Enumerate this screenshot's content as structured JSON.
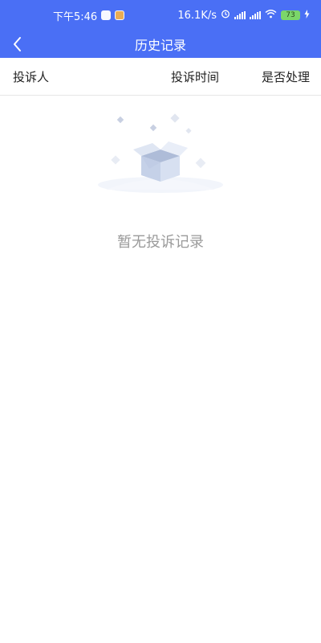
{
  "status_bar": {
    "time": "下午5:46",
    "network_speed": "16.1K/s",
    "battery_level": "73"
  },
  "header": {
    "title": "历史记录",
    "back_icon": "chevron-left-icon"
  },
  "table_header": {
    "complainant": "投诉人",
    "complaint_time": "投诉时间",
    "handled": "是否处理"
  },
  "empty_state": {
    "message": "暂无投诉记录",
    "illustration": "empty-box-illustration"
  },
  "colors": {
    "brand_blue": "#4a6ff5",
    "empty_text": "#9a9a9a",
    "divider": "#e6e6e6"
  }
}
